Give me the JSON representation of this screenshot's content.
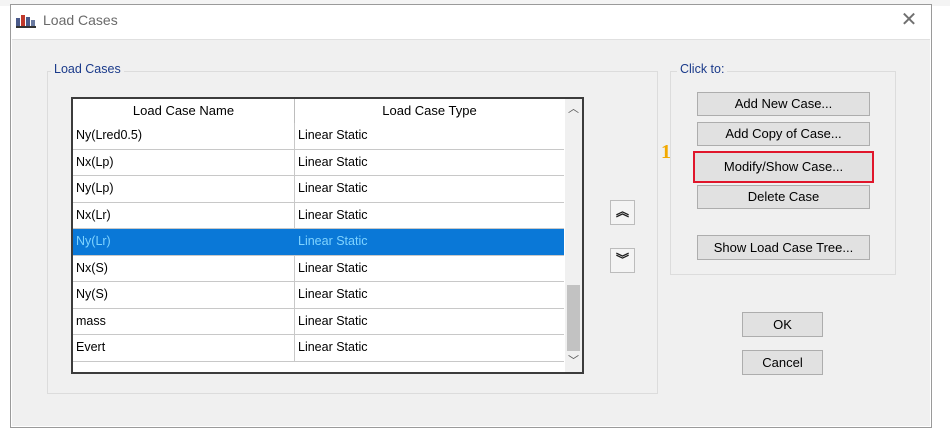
{
  "window": {
    "title": "Load Cases",
    "close_glyph": "✕"
  },
  "load_cases_group": {
    "label": "Load Cases",
    "columns": [
      "Load Case Name",
      "Load Case Type"
    ],
    "rows": [
      {
        "name": "Ny(Lred0.5)",
        "type": "Linear Static",
        "selected": false
      },
      {
        "name": "Nx(Lp)",
        "type": "Linear Static",
        "selected": false
      },
      {
        "name": "Ny(Lp)",
        "type": "Linear Static",
        "selected": false
      },
      {
        "name": "Nx(Lr)",
        "type": "Linear Static",
        "selected": false
      },
      {
        "name": "Ny(Lr)",
        "type": "Linear Static",
        "selected": true
      },
      {
        "name": "Nx(S)",
        "type": "Linear Static",
        "selected": false
      },
      {
        "name": "Ny(S)",
        "type": "Linear Static",
        "selected": false
      },
      {
        "name": "mass",
        "type": "Linear Static",
        "selected": false
      },
      {
        "name": "Evert",
        "type": "Linear Static",
        "selected": false
      }
    ],
    "selected_row_color": "#0a78d7",
    "selected_text_color": "#7fd3ff",
    "move_up_glyph": "︽",
    "move_down_glyph": "︾",
    "scroll_up_glyph": "︿",
    "scroll_down_glyph": "﹀"
  },
  "click_to_group": {
    "label": "Click to:",
    "add_new": "Add New Case...",
    "add_copy": "Add Copy of Case...",
    "modify_show": "Modify/Show Case...",
    "delete": "Delete Case",
    "show_tree": "Show Load Case Tree..."
  },
  "annotation": {
    "marker": "1",
    "highlight_color": "#e0162b",
    "marker_color": "#f2a900"
  },
  "dialog_buttons": {
    "ok": "OK",
    "cancel": "Cancel"
  }
}
